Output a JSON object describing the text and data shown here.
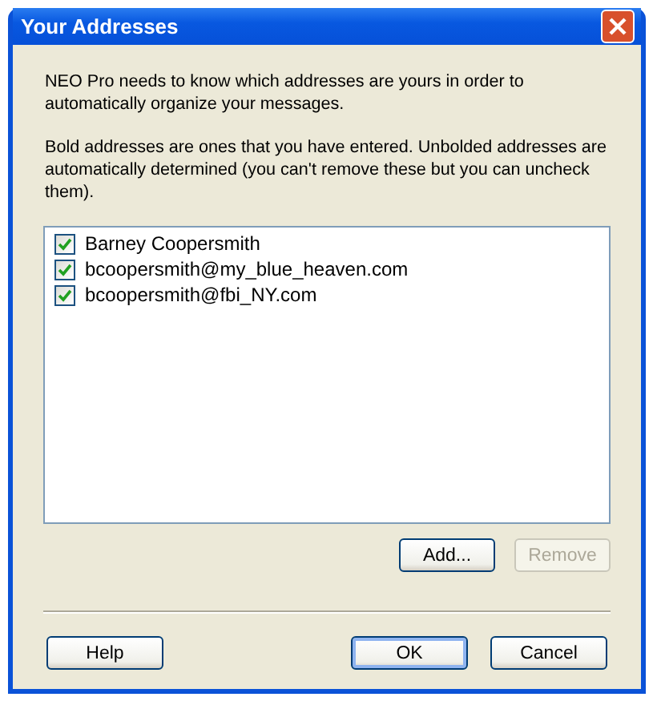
{
  "window": {
    "title": "Your Addresses"
  },
  "intro": "NEO Pro needs to know which addresses are yours in order to automatically organize your messages.",
  "note": "Bold addresses are ones that you have entered. Unbolded addresses are automatically determined (you can't remove these but you can uncheck them).",
  "addresses": [
    {
      "label": "Barney Coopersmith",
      "checked": true
    },
    {
      "label": "bcoopersmith@my_blue_heaven.com",
      "checked": true
    },
    {
      "label": "bcoopersmith@fbi_NY.com",
      "checked": true
    }
  ],
  "list_buttons": [
    {
      "label": "Add...",
      "disabled": false
    },
    {
      "label": "Remove",
      "disabled": true
    }
  ],
  "footer_left_buttons": [
    {
      "label": "Help",
      "default": false
    }
  ],
  "footer_right_buttons": [
    {
      "label": "OK",
      "default": true
    },
    {
      "label": "Cancel",
      "default": false
    }
  ]
}
